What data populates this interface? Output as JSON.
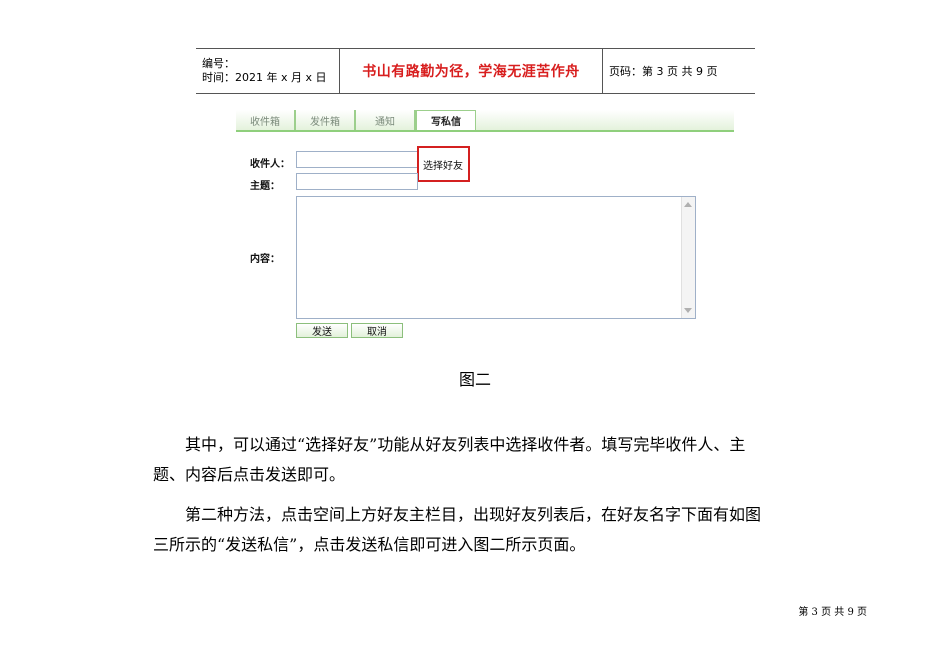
{
  "header": {
    "number_label": "编号：",
    "time_label": "时间：2021 年 x 月 x 日",
    "motto": "书山有路勤为径，学海无涯苦作舟",
    "page_code": "页码：第 3 页 共 9 页"
  },
  "figure": {
    "tabs": [
      "收件箱",
      "发件箱",
      "通知",
      "写私信"
    ],
    "active_tab": "写私信",
    "recipient_label": "收件人：",
    "subject_label": "主题：",
    "content_label": "内容：",
    "select_friend": "选择好友",
    "send_button": "发送",
    "cancel_button": "取消",
    "caption": "图二"
  },
  "body": {
    "para1_line1": "其中，可以通过“选择好友”功能从好友列表中选择收件者。填写完毕收件人、主",
    "para1_line2": "题、内容后点击发送即可。",
    "para2_line1": "第二种方法，点击空间上方好友主栏目，出现好友列表后，在好友名字下面有如图",
    "para2_line2": "三所示的“发送私信”，点击发送私信即可进入图二所示页面。"
  },
  "footer": {
    "page": "第 3 页 共 9 页"
  }
}
